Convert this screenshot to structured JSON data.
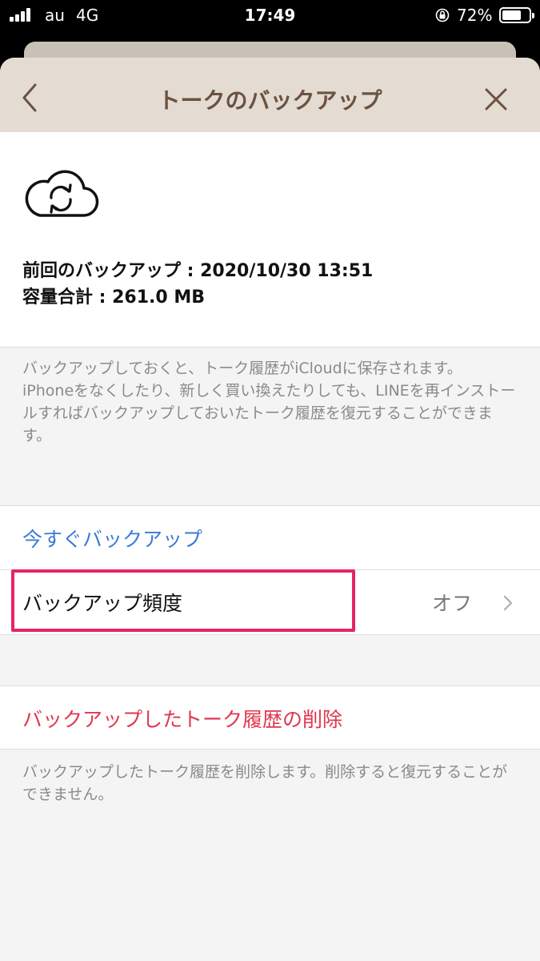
{
  "status_bar": {
    "carrier": "au",
    "network": "4G",
    "time": "17:49",
    "battery_percent": "72%",
    "battery_level": 0.72,
    "icons": [
      "signal-icon",
      "orientation-lock-icon",
      "battery-icon"
    ]
  },
  "nav": {
    "title": "トークのバックアップ",
    "back_icon": "chevron-left-icon",
    "close_icon": "close-icon",
    "bar_color": "#e4dcd3",
    "title_color": "#6b5240"
  },
  "info": {
    "icon": "cloud-sync-icon",
    "last_backup": "前回のバックアップ : 2020/10/30 13:51",
    "capacity": "容量合計 : 261.0 MB"
  },
  "description": "バックアップしておくと、トーク履歴がiCloudに保存されます。\niPhoneをなくしたり、新しく買い換えたりしても、LINEを再インストールすればバックアップしておいたトーク履歴を復元することができます。",
  "actions": {
    "backup_now": "今すぐバックアップ",
    "frequency_label": "バックアップ頻度",
    "frequency_value": "オフ",
    "link_color": "#3d7ad6",
    "highlight_color": "#e6246a"
  },
  "delete": {
    "label": "バックアップしたトーク履歴の削除",
    "color": "#e0364f",
    "description": "バックアップしたトーク履歴を削除します。削除すると復元することができません。"
  }
}
